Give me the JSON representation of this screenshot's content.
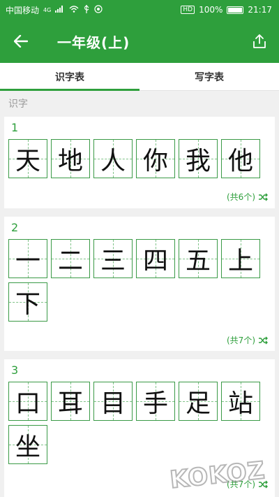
{
  "status_bar": {
    "carrier": "中国移动",
    "network": "4G",
    "hd_badge": "HD",
    "battery": "100%",
    "time": "21:17"
  },
  "toolbar": {
    "title": "一年级(上)",
    "back_icon": "back-arrow-icon",
    "share_icon": "share-icon"
  },
  "tabs": [
    {
      "label": "识字表",
      "active": true
    },
    {
      "label": "写字表",
      "active": false
    }
  ],
  "section_label": "识字",
  "groups": [
    {
      "num": "1",
      "chars": [
        "天",
        "地",
        "人",
        "你",
        "我",
        "他"
      ],
      "count_label": "(共6个)"
    },
    {
      "num": "2",
      "chars": [
        "一",
        "二",
        "三",
        "四",
        "五",
        "上",
        "下"
      ],
      "count_label": "(共7个)"
    },
    {
      "num": "3",
      "chars": [
        "口",
        "耳",
        "目",
        "手",
        "足",
        "站",
        "坐"
      ],
      "count_label": "(共7个)"
    }
  ],
  "colors": {
    "accent": "#2e9f3c"
  },
  "watermark_text": "KOKOZ"
}
